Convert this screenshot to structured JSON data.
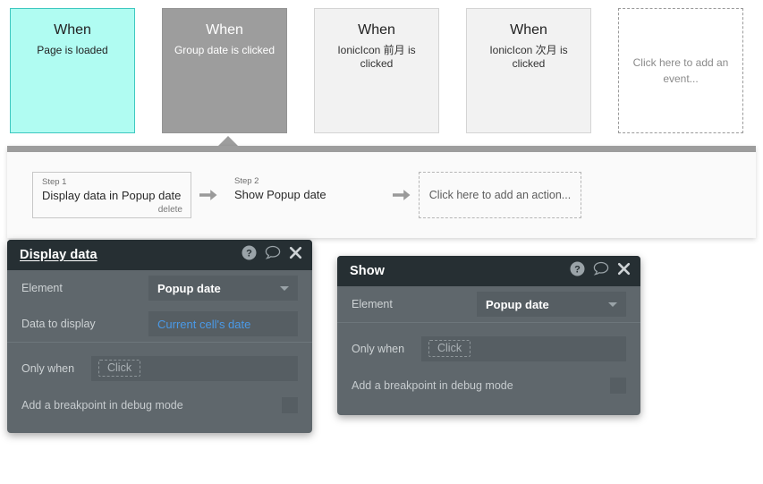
{
  "events": {
    "cards": [
      {
        "when": "When",
        "desc": "Page is loaded",
        "state": "selected"
      },
      {
        "when": "When",
        "desc": "Group date is clicked",
        "state": "highlighted"
      },
      {
        "when": "When",
        "desc": "IonicIcon 前月 is clicked",
        "state": "normal"
      },
      {
        "when": "When",
        "desc": "IonicIcon 次月 is clicked",
        "state": "normal"
      }
    ],
    "add_placeholder": "Click here to add an event..."
  },
  "actions": {
    "steps": [
      {
        "num": "Step 1",
        "title": "Display data in Popup date",
        "delete": "delete"
      },
      {
        "num": "Step 2",
        "title": "Show Popup date"
      }
    ],
    "add_placeholder": "Click here to add an action..."
  },
  "dialogs": {
    "display_data": {
      "title": "Display data",
      "icons": {
        "help": "help-icon",
        "comment": "comment-icon",
        "close": "close-icon"
      },
      "element_label": "Element",
      "element_value": "Popup date",
      "data_label": "Data to display",
      "data_value": "Current cell's date",
      "onlywhen_label": "Only when",
      "onlywhen_placeholder": "Click",
      "breakpoint_label": "Add a breakpoint in debug mode"
    },
    "show": {
      "title": "Show",
      "icons": {
        "help": "help-icon",
        "comment": "comment-icon",
        "close": "close-icon"
      },
      "element_label": "Element",
      "element_value": "Popup date",
      "onlywhen_label": "Only when",
      "onlywhen_placeholder": "Click",
      "breakpoint_label": "Add a breakpoint in debug mode"
    }
  },
  "colors": {
    "selected_event": "#b0fcf2",
    "highlighted_event": "#9d9d9d",
    "dialog_header": "#262f33",
    "dialog_body": "#5f676c",
    "link_blue": "#4a9ae8"
  }
}
